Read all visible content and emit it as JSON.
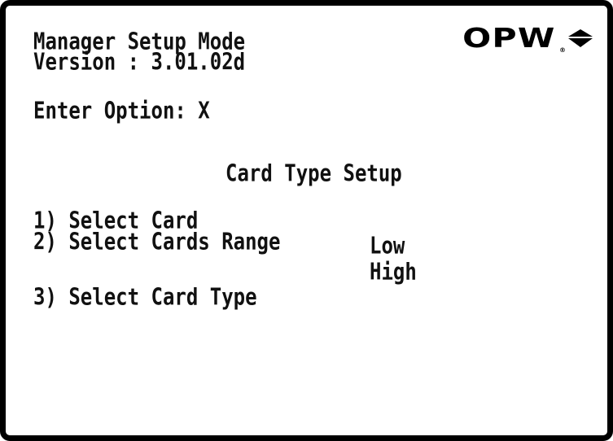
{
  "header": {
    "title": "Manager Setup Mode",
    "version": "Version : 3.01.02d",
    "logo_text": "OPW",
    "logo_reg": "®"
  },
  "prompt": {
    "text": "Enter Option: X"
  },
  "section": {
    "heading": "Card Type Setup"
  },
  "menu": {
    "items": [
      {
        "label": "1) Select Card"
      },
      {
        "label": "2) Select Cards Range"
      },
      {
        "label": "3) Select Card Type"
      }
    ]
  },
  "range": {
    "low_label": "Low",
    "high_label": "High"
  },
  "colors": {
    "text": "#111111",
    "background": "#ffffff",
    "border": "#000000"
  }
}
